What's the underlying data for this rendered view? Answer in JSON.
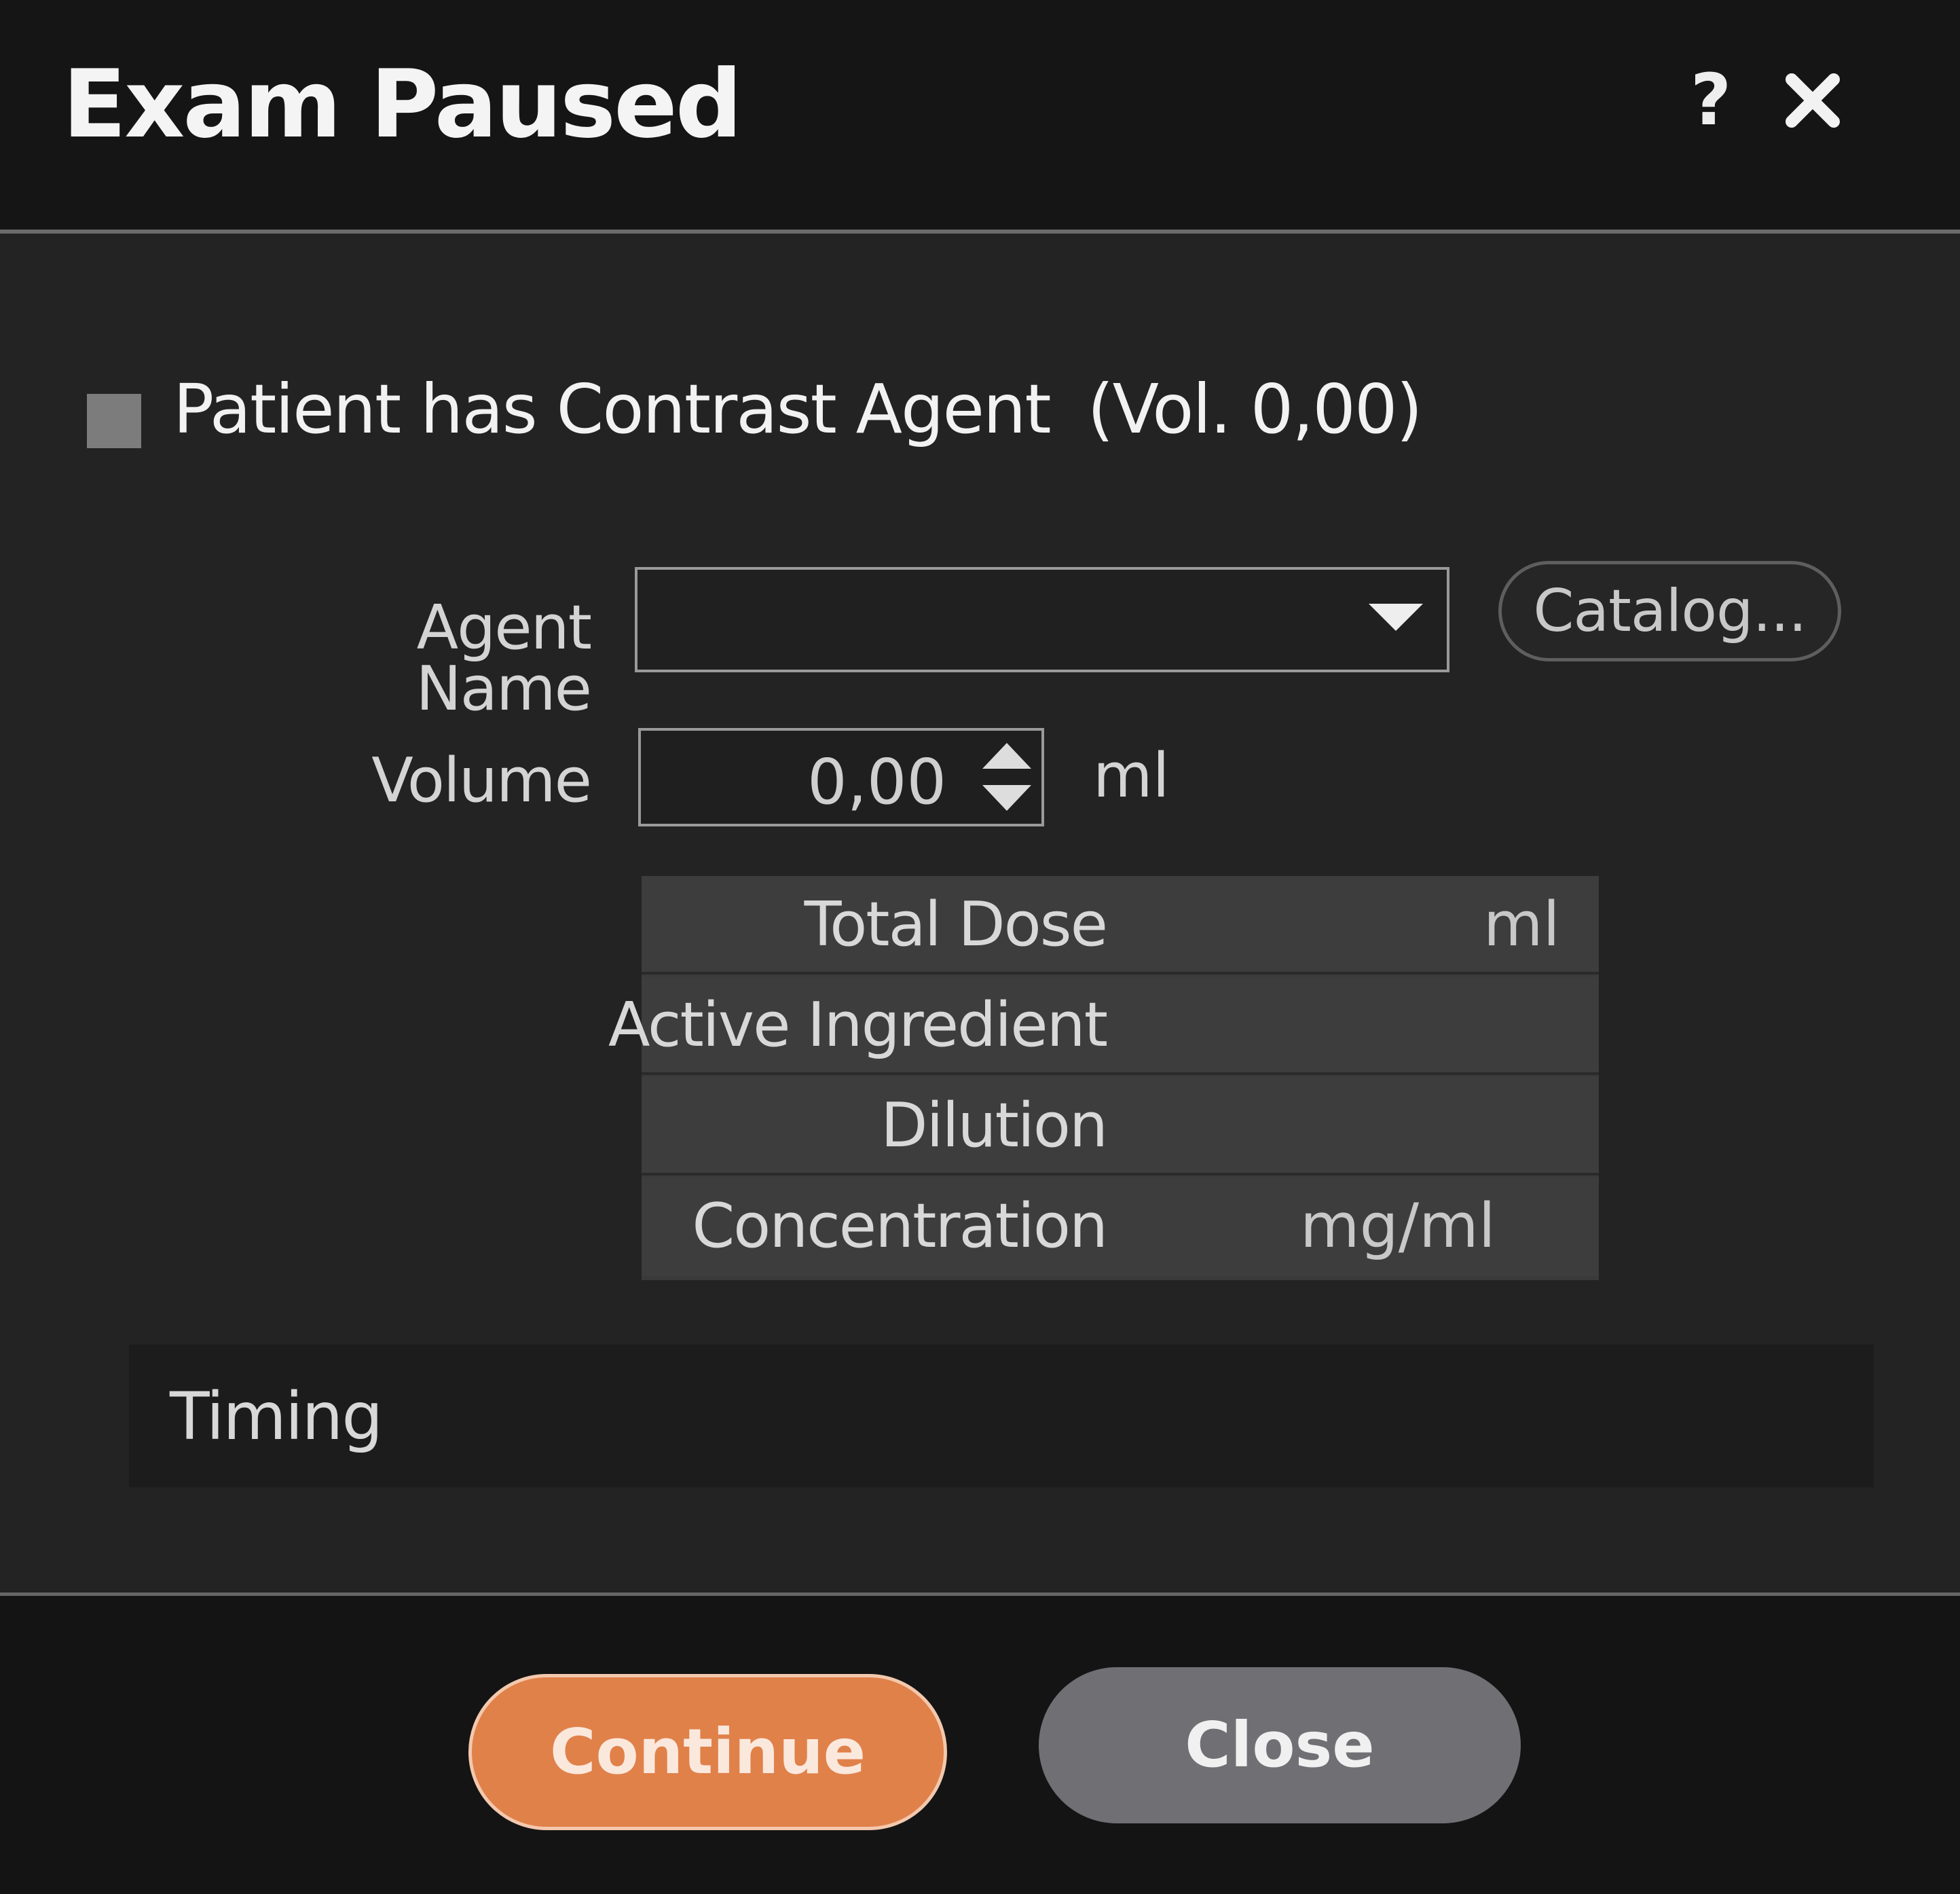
{
  "window": {
    "title": "Exam Paused",
    "help_label": "?"
  },
  "contrast": {
    "checkbox_label": "Patient has Contrast Agent",
    "volume_summary": "(Vol. 0,00)"
  },
  "form": {
    "agent_name_label": "Agent Name",
    "agent_name_value": "",
    "catalog_label": "Catalog...",
    "volume_label": "Volume",
    "volume_value": "0,00",
    "volume_unit": "ml"
  },
  "dose_table": [
    {
      "name": "Total Dose",
      "unit": "ml"
    },
    {
      "name": "Active Ingredient",
      "unit": ""
    },
    {
      "name": "Dilution",
      "unit": ""
    },
    {
      "name": "Concentration",
      "unit": "mg/ml"
    }
  ],
  "timing": {
    "label": "Timing"
  },
  "buttons": {
    "continue_label": "Continue",
    "close_label": "Close"
  },
  "colors": {
    "accent": "#e0814a",
    "secondary_button": "#6f6f74",
    "background": "#232323"
  }
}
